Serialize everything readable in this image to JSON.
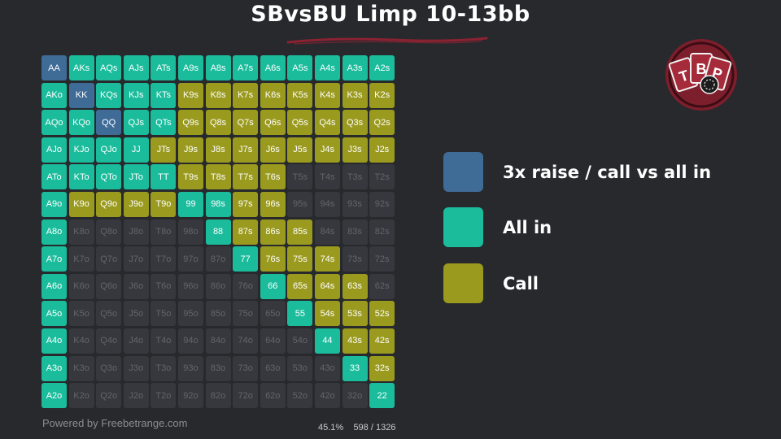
{
  "title": "SBvsBU Limp 10-13bb",
  "logo_text": "TBP",
  "colors": {
    "raise": "#3f6b97",
    "allin": "#1abc9c",
    "call": "#9a9a1f",
    "fold": "#36383d",
    "background": "#27292d",
    "underline": "#8b2232",
    "logo": "#8b2232"
  },
  "legend": [
    {
      "key": "raise",
      "label": "3x raise / call vs all in"
    },
    {
      "key": "allin",
      "label": "All in"
    },
    {
      "key": "call",
      "label": "Call"
    }
  ],
  "grid": {
    "ranks": [
      "A",
      "K",
      "Q",
      "J",
      "T",
      "9",
      "8",
      "7",
      "6",
      "5",
      "4",
      "3",
      "2"
    ],
    "rows": [
      "RAAAAAAAAAAAA",
      "ARAAACCCCCCCC",
      "AARAACCCCCCCC",
      "AAAACCCCCCCCC",
      "AAAAACCCCFFFF",
      "ACCCCAACCFFFF",
      "AFFFFFACCCFFF",
      "AFFFFFFACCCFF",
      "AFFFFFFFACCCF",
      "AFFFFFFFFACCC",
      "AFFFFFFFFFACC",
      "AFFFFFFFFFFAC",
      "AFFFFFFFFFFFA"
    ]
  },
  "footer": {
    "powered_by": "Powered by Freebetrange.com",
    "percent": "45.1%",
    "combos": "598 / 1326"
  }
}
